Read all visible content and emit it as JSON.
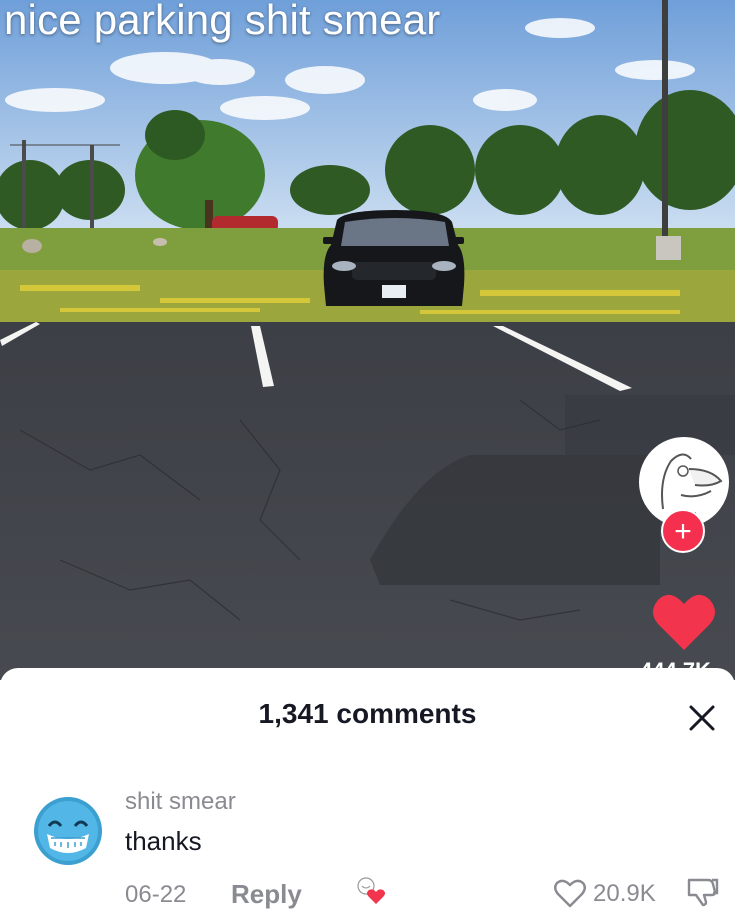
{
  "video": {
    "caption": "nice parking shit smear",
    "like_count": "444.7K"
  },
  "comments_sheet": {
    "count_label": "1,341 comments",
    "comments": [
      {
        "author": "shit smear",
        "text": "thanks",
        "date": "06-22",
        "reply_label": "Reply",
        "like_count": "20.9K"
      }
    ]
  },
  "colors": {
    "accent": "#f5304f",
    "muted_text": "#8a8b91",
    "primary_text": "#161823"
  },
  "icons": [
    "plus-icon",
    "heart-icon",
    "close-icon",
    "smiley-avatar-icon",
    "creator-liked-icon",
    "heart-outline-icon",
    "thumbs-down-icon"
  ]
}
